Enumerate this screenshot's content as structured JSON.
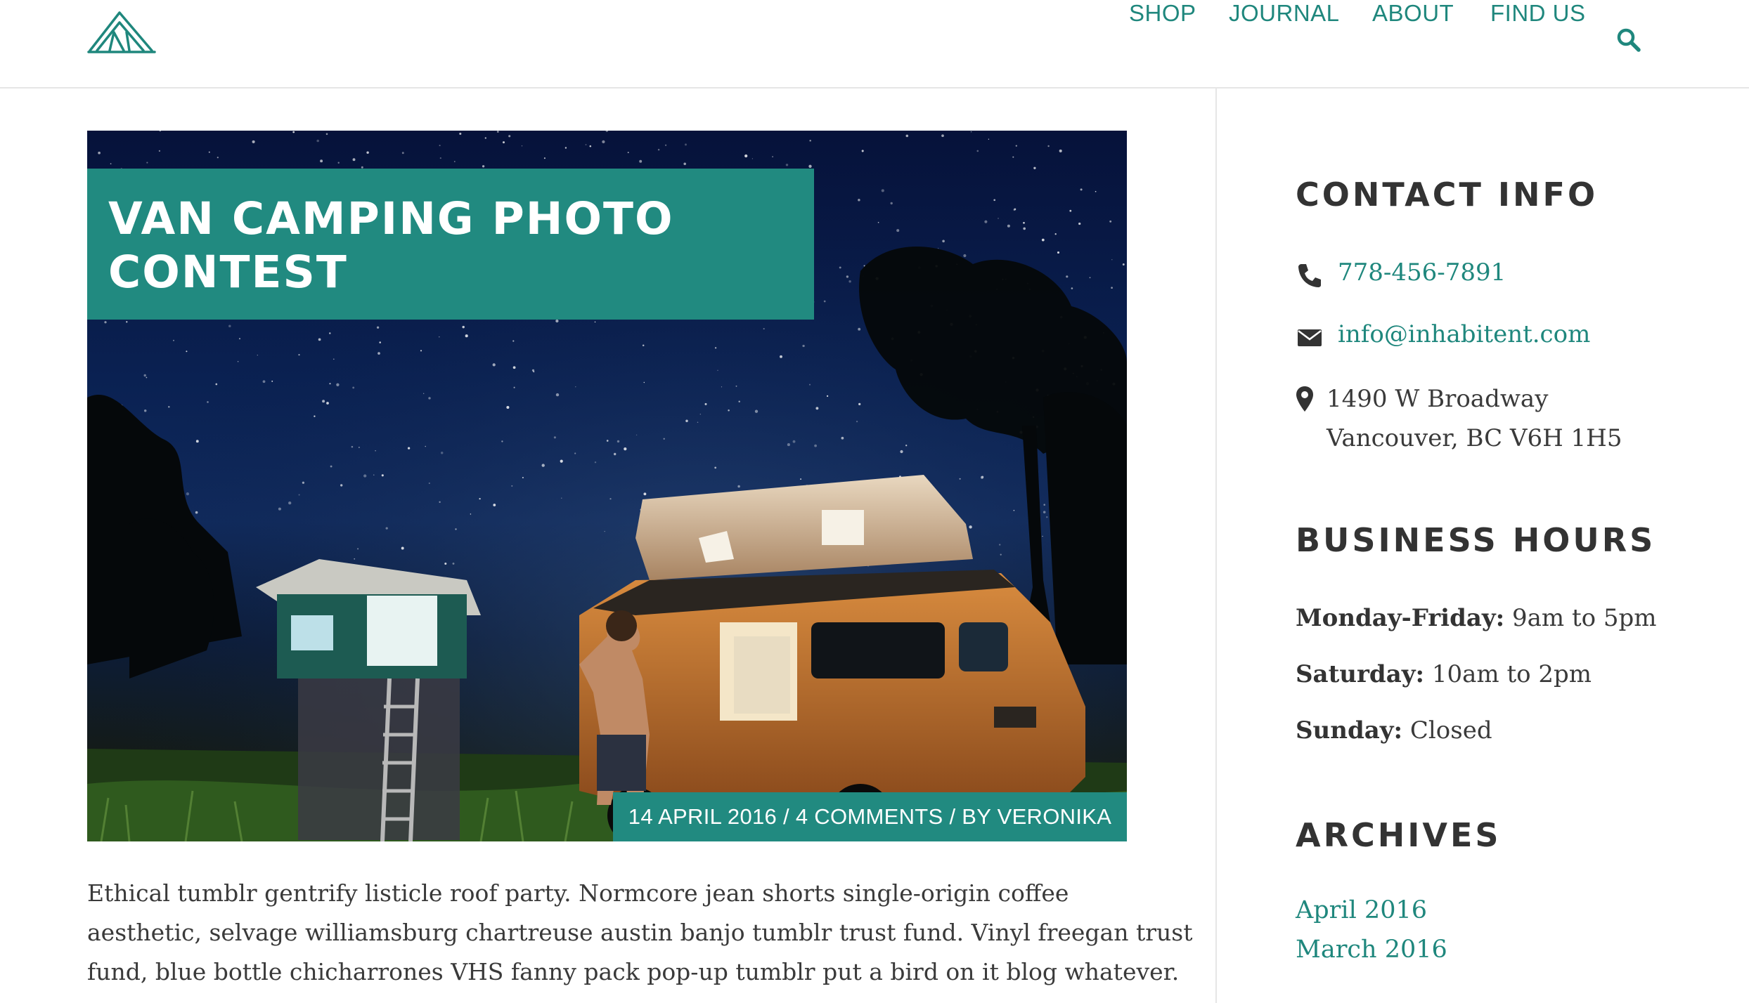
{
  "nav": {
    "items": [
      {
        "label": "SHOP"
      },
      {
        "label": "JOURNAL"
      },
      {
        "label": "ABOUT"
      },
      {
        "label": "FIND US"
      }
    ],
    "search_icon": "search-icon",
    "logo_icon": "tent-logo-icon"
  },
  "post": {
    "title_line1": "VAN CAMPING PHOTO",
    "title_line2": "CONTEST",
    "date": "14 APRIL 2016",
    "comments": "4 COMMENTS",
    "author": "BY VERONIKA",
    "separator": " / ",
    "body_lines": [
      "Ethical tumblr gentrify listicle roof party. Normcore jean shorts single-origin coffee",
      "aesthetic, selvage williamsburg chartreuse austin banjo tumblr trust fund. Vinyl freegan trust",
      "fund, blue bottle chicharrones VHS fanny pack pop-up tumblr put a bird on it blog whatever."
    ]
  },
  "sidebar": {
    "contact": {
      "title": "CONTACT INFO",
      "phone": "778-456-7891",
      "email": "info@inhabitent.com",
      "address_line1": "1490 W Broadway",
      "address_line2": "Vancouver, BC V6H 1H5"
    },
    "hours": {
      "title": "BUSINESS HOURS",
      "rows": [
        {
          "day": "Monday-Friday:",
          "time": "9am to 5pm"
        },
        {
          "day": "Saturday:",
          "time": "10am to 2pm"
        },
        {
          "day": "Sunday:",
          "time": "Closed"
        }
      ]
    },
    "archives": {
      "title": "ARCHIVES",
      "items": [
        "April 2016",
        "March 2016"
      ]
    }
  },
  "colors": {
    "accent": "#218a80",
    "link": "#1f877d",
    "text": "#3a3a3a",
    "heading": "#333333"
  }
}
